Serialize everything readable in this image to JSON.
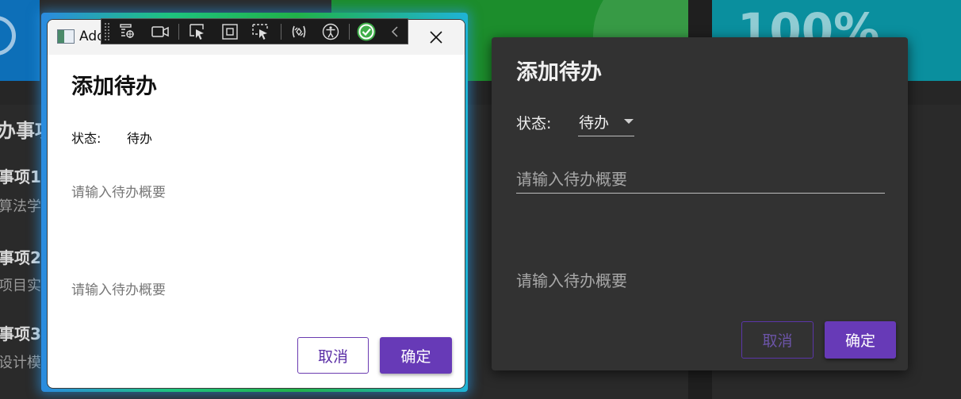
{
  "background": {
    "tile_percent": "100%",
    "section_heading": "办事项",
    "items": [
      {
        "title": "事项1",
        "subtitle": "算法学"
      },
      {
        "title": "事项2",
        "subtitle": "项目实"
      },
      {
        "title": "事项3",
        "subtitle": "设计模"
      }
    ]
  },
  "light_window": {
    "title_text": "Add",
    "heading": "添加待办",
    "status_label": "状态:",
    "status_value": "待办",
    "summary_placeholder_1": "请输入待办概要",
    "summary_placeholder_2": "请输入待办概要",
    "cancel_label": "取消",
    "ok_label": "确定",
    "close_icon": "close-icon",
    "app_icon": "window-app-icon"
  },
  "debug_toolbar": {
    "icons": [
      "grip-handle-icon",
      "live-visual-tree-icon",
      "record-video-icon",
      "select-element-icon",
      "display-layout-adorners-icon",
      "track-focused-element-icon",
      "hot-reload-icon",
      "accessibility-icon",
      "binding-ok-icon",
      "collapse-chevron-icon"
    ]
  },
  "dark_dialog": {
    "heading": "添加待办",
    "status_label": "状态:",
    "status_value": "待办",
    "summary_placeholder_1": "请输入待办概要",
    "summary_placeholder_2": "请输入待办概要",
    "cancel_label": "取消",
    "ok_label": "确定"
  },
  "colors": {
    "accent_purple": "#673ab7",
    "tile_blue": "#0d6fb8",
    "tile_green": "#1c8d2c",
    "tile_teal": "#0a8f9e",
    "dialog_dark": "#323232"
  }
}
